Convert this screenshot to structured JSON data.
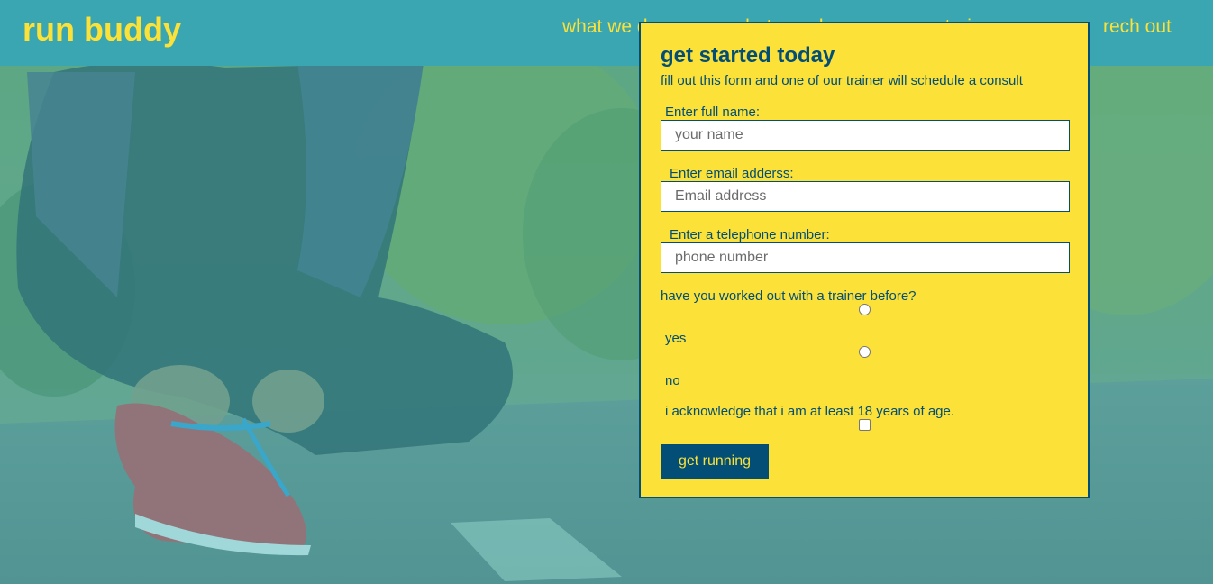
{
  "header": {
    "logo": "run buddy",
    "nav": [
      {
        "label": "what we do"
      },
      {
        "label": "what you do"
      },
      {
        "label": "your trainers"
      },
      {
        "label": "rech out"
      }
    ]
  },
  "form": {
    "title": "get started today",
    "subtitle": "fill out this form and one of our trainer will schedule a consult",
    "name": {
      "label": "Enter full name:",
      "placeholder": "your name",
      "value": ""
    },
    "email": {
      "label": "Enter email adderss:",
      "placeholder": "Email address",
      "value": ""
    },
    "phone": {
      "label": "Enter a telephone number:",
      "placeholder": "phone number",
      "value": ""
    },
    "trainer_question": "have you worked out with a trainer before?",
    "options": [
      {
        "label": "yes",
        "checked": false
      },
      {
        "label": "no",
        "checked": false
      }
    ],
    "acknowledge": {
      "label": "i acknowledge that i am at least 18 years of age.",
      "checked": false
    },
    "submit_label": "get running"
  },
  "colors": {
    "header_bg": "#39a6b2",
    "accent_yellow": "#fce138",
    "dark_blue": "#024e76"
  }
}
